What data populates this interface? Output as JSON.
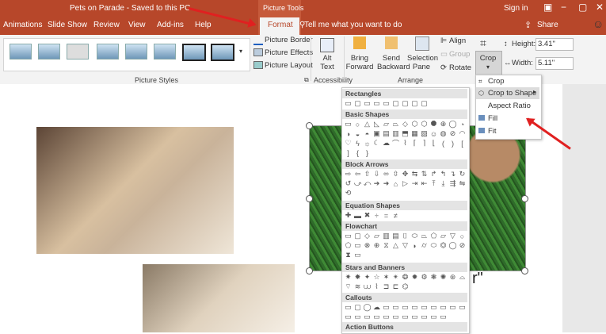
{
  "titlebar": {
    "title": "Pets on Parade  -  Saved to this PC",
    "tools_label": "Picture Tools",
    "sign_in": "Sign in",
    "window_min": "−",
    "window_max": "▢",
    "window_close": "✕"
  },
  "tabs": {
    "animations": "Animations",
    "slideshow": "Slide Show",
    "review": "Review",
    "view": "View",
    "addins": "Add-ins",
    "help": "Help",
    "format": "Format"
  },
  "tell_me": {
    "placeholder": "Tell me what you want to do"
  },
  "share": {
    "label": "Share"
  },
  "ribbon": {
    "picture_border": "Picture Border",
    "picture_effects": "Picture Effects",
    "picture_layout": "Picture Layout",
    "picture_styles": "Picture Styles",
    "accessibility": "Accessibility",
    "arrange": "Arrange",
    "alt_text": "Alt Text",
    "bring_forward": "Bring Forward",
    "send_backward": "Send Backward",
    "selection_pane": "Selection Pane",
    "align": "Align",
    "group": "Group",
    "rotate": "Rotate",
    "crop": "Crop",
    "height_label": "Height:",
    "height_value": "3.41\"",
    "width_label": "Width:",
    "width_value": "5.11\""
  },
  "shapes_menu": {
    "rectangles": "Rectangles",
    "basic_shapes": "Basic Shapes",
    "block_arrows": "Block Arrows",
    "equation_shapes": "Equation Shapes",
    "flowchart": "Flowchart",
    "stars_banners": "Stars and Banners",
    "callouts": "Callouts",
    "action_buttons": "Action Buttons"
  },
  "crop_menu": {
    "crop": "Crop",
    "crop_to_shape": "Crop to Shape",
    "aspect_ratio": "Aspect Ratio",
    "fill": "Fill",
    "fit": "Fit"
  },
  "slide": {
    "quote_char": "r\""
  },
  "colors": {
    "accent": "#b7472a",
    "arrow": "#e02020"
  }
}
